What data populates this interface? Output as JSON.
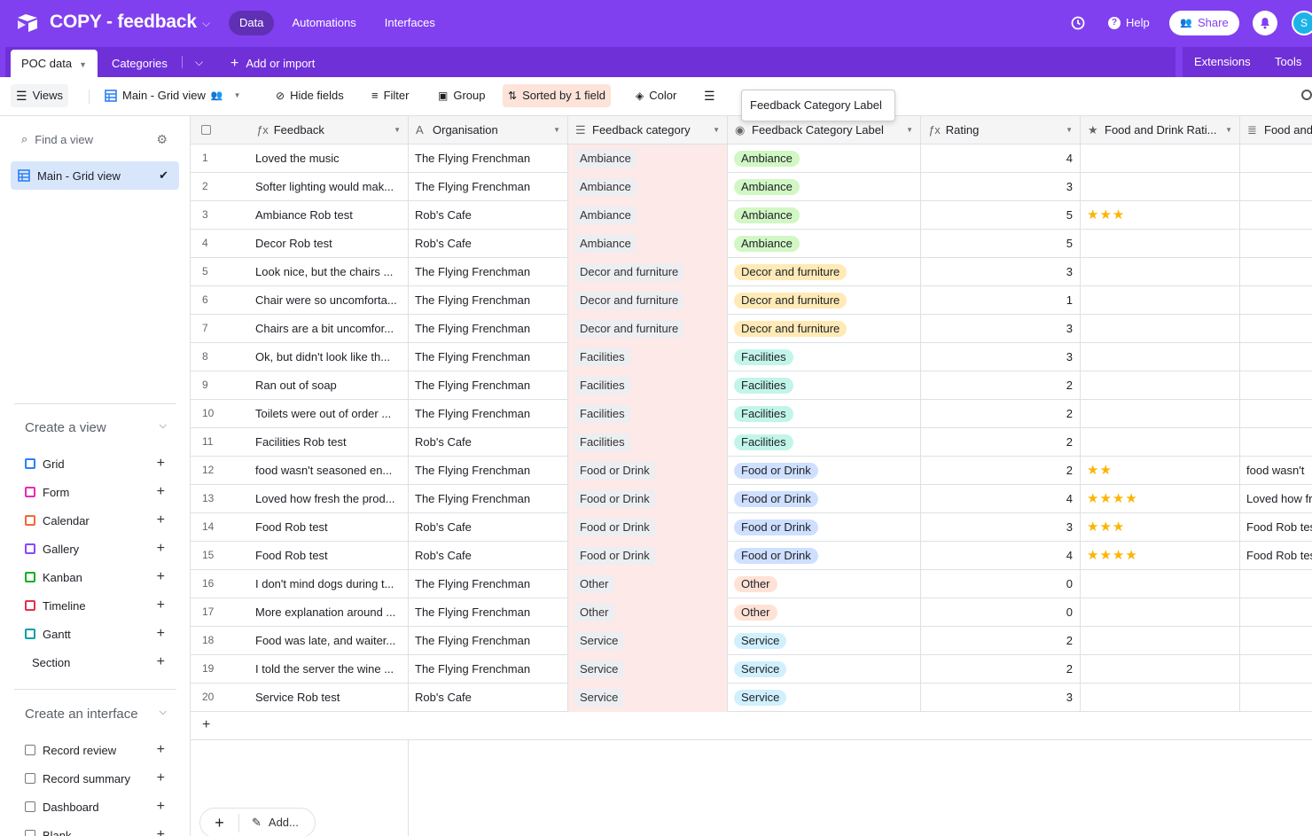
{
  "app": {
    "base_title": "COPY - feedback",
    "nav_tabs": [
      "Data",
      "Automations",
      "Interfaces"
    ],
    "help": "Help",
    "share": "Share",
    "avatar_initial": "S"
  },
  "tables": {
    "active": "POC data",
    "other": "Categories",
    "add": "Add or import",
    "extensions": "Extensions",
    "tools": "Tools"
  },
  "viewbar": {
    "views": "Views",
    "current_view": "Main - Grid view",
    "hide_fields": "Hide fields",
    "filter": "Filter",
    "group": "Group",
    "sorted": "Sorted by 1 field",
    "color": "Color"
  },
  "tooltip": "Feedback Category Label",
  "sidebar": {
    "find_placeholder": "Find a view",
    "active_view": "Main - Grid view",
    "create_view": "Create a view",
    "view_types": [
      {
        "label": "Grid",
        "color": "#2d7ff9"
      },
      {
        "label": "Form",
        "color": "#e929ba"
      },
      {
        "label": "Calendar",
        "color": "#f7653b"
      },
      {
        "label": "Gallery",
        "color": "#8b46ff"
      },
      {
        "label": "Kanban",
        "color": "#11af22"
      },
      {
        "label": "Timeline",
        "color": "#e52e4d"
      },
      {
        "label": "Gantt",
        "color": "#0c9ea3"
      },
      {
        "label": "Section",
        "color": ""
      }
    ],
    "create_interface": "Create an interface",
    "interface_types": [
      "Record review",
      "Record summary",
      "Dashboard",
      "Blank"
    ]
  },
  "grid": {
    "headers": [
      "Feedback",
      "Organisation",
      "Feedback category",
      "Feedback Category Label",
      "Rating",
      "Food and Drink Rati...",
      "Food and"
    ],
    "add_label": "Add...",
    "label_colors": {
      "Ambiance": "#d1f7c4",
      "Decor and furniture": "#ffeab6",
      "Facilities": "#c2f5e9",
      "Food or Drink": "#cfdfff",
      "Other": "#fee2d5",
      "Service": "#d0f0fd"
    },
    "rows": [
      {
        "n": "1",
        "feedback": "Loved the music",
        "org": "The Flying Frenchman",
        "cat": "Ambiance",
        "rating": "4",
        "stars": "",
        "food": ""
      },
      {
        "n": "2",
        "feedback": "Softer lighting would mak...",
        "org": "The Flying Frenchman",
        "cat": "Ambiance",
        "rating": "3",
        "stars": "",
        "food": ""
      },
      {
        "n": "3",
        "feedback": "Ambiance Rob test",
        "org": "Rob's Cafe",
        "cat": "Ambiance",
        "rating": "5",
        "stars": "★★★",
        "food": ""
      },
      {
        "n": "4",
        "feedback": "Decor Rob test",
        "org": "Rob's Cafe",
        "cat": "Ambiance",
        "rating": "5",
        "stars": "",
        "food": ""
      },
      {
        "n": "5",
        "feedback": "Look nice, but the chairs ...",
        "org": "The Flying Frenchman",
        "cat": "Decor and furniture",
        "rating": "3",
        "stars": "",
        "food": ""
      },
      {
        "n": "6",
        "feedback": "Chair were so uncomforta...",
        "org": "The Flying Frenchman",
        "cat": "Decor and furniture",
        "rating": "1",
        "stars": "",
        "food": ""
      },
      {
        "n": "7",
        "feedback": "Chairs are a bit uncomfor...",
        "org": "The Flying Frenchman",
        "cat": "Decor and furniture",
        "rating": "3",
        "stars": "",
        "food": ""
      },
      {
        "n": "8",
        "feedback": "Ok, but didn't look like th...",
        "org": "The Flying Frenchman",
        "cat": "Facilities",
        "rating": "3",
        "stars": "",
        "food": ""
      },
      {
        "n": "9",
        "feedback": "Ran out of soap",
        "org": "The Flying Frenchman",
        "cat": "Facilities",
        "rating": "2",
        "stars": "",
        "food": ""
      },
      {
        "n": "10",
        "feedback": "Toilets were out of order ...",
        "org": "The Flying Frenchman",
        "cat": "Facilities",
        "rating": "2",
        "stars": "",
        "food": ""
      },
      {
        "n": "11",
        "feedback": "Facilities Rob test",
        "org": "Rob's Cafe",
        "cat": "Facilities",
        "rating": "2",
        "stars": "",
        "food": ""
      },
      {
        "n": "12",
        "feedback": "food wasn't seasoned en...",
        "org": "The Flying Frenchman",
        "cat": "Food or Drink",
        "rating": "2",
        "stars": "★★",
        "food": "food wasn't"
      },
      {
        "n": "13",
        "feedback": "Loved how fresh the prod...",
        "org": "The Flying Frenchman",
        "cat": "Food or Drink",
        "rating": "4",
        "stars": "★★★★",
        "food": "Loved how fr"
      },
      {
        "n": "14",
        "feedback": "Food Rob test",
        "org": "Rob's Cafe",
        "cat": "Food or Drink",
        "rating": "3",
        "stars": "★★★",
        "food": "Food Rob tes"
      },
      {
        "n": "15",
        "feedback": "Food Rob test",
        "org": "Rob's Cafe",
        "cat": "Food or Drink",
        "rating": "4",
        "stars": "★★★★",
        "food": "Food Rob tes"
      },
      {
        "n": "16",
        "feedback": "I don't mind dogs during t...",
        "org": "The Flying Frenchman",
        "cat": "Other",
        "rating": "0",
        "stars": "",
        "food": ""
      },
      {
        "n": "17",
        "feedback": "More explanation around ...",
        "org": "The Flying Frenchman",
        "cat": "Other",
        "rating": "0",
        "stars": "",
        "food": ""
      },
      {
        "n": "18",
        "feedback": "Food was late, and waiter...",
        "org": "The Flying Frenchman",
        "cat": "Service",
        "rating": "2",
        "stars": "",
        "food": ""
      },
      {
        "n": "19",
        "feedback": "I told the server the wine ...",
        "org": "The Flying Frenchman",
        "cat": "Service",
        "rating": "2",
        "stars": "",
        "food": ""
      },
      {
        "n": "20",
        "feedback": "Service Rob test",
        "org": "Rob's Cafe",
        "cat": "Service",
        "rating": "3",
        "stars": "",
        "food": ""
      }
    ]
  }
}
